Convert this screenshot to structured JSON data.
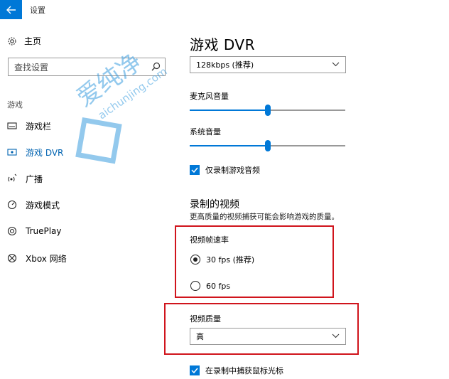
{
  "window": {
    "title": "设置"
  },
  "sidebar": {
    "home_label": "主页",
    "search_placeholder": "查找设置",
    "section_label": "游戏",
    "items": [
      {
        "label": "游戏栏",
        "icon": "game-bar-icon"
      },
      {
        "label": "游戏 DVR",
        "icon": "dvr-icon",
        "active": true
      },
      {
        "label": "广播",
        "icon": "broadcast-icon"
      },
      {
        "label": "游戏模式",
        "icon": "game-mode-icon"
      },
      {
        "label": "TruePlay",
        "icon": "trueplay-icon"
      },
      {
        "label": "Xbox 网络",
        "icon": "xbox-icon"
      }
    ]
  },
  "main": {
    "title": "游戏 DVR",
    "bitrate_value": "128kbps (推荐)",
    "mic_volume_label": "麦克风音量",
    "mic_volume_level": 0.5,
    "system_volume_label": "系统音量",
    "system_volume_level": 0.5,
    "record_game_audio_only_label": "仅录制游戏音频",
    "record_game_audio_only_checked": true,
    "recorded_video_title": "录制的视频",
    "recorded_video_desc": "更高质量的视频捕获可能会影响游戏的质量。",
    "frame_rate_label": "视频帧速率",
    "frame_rate_options": [
      {
        "label": "30 fps (推荐)",
        "selected": true
      },
      {
        "label": "60 fps",
        "selected": false
      }
    ],
    "video_quality_label": "视频质量",
    "video_quality_value": "高",
    "capture_cursor_label": "在录制中捕获鼠标光标",
    "capture_cursor_checked": true
  },
  "watermark": {
    "text_cn": "爱纯净",
    "text_en": "aichunjing.com"
  },
  "colors": {
    "accent": "#0078d7",
    "highlight_box": "#d0141c"
  }
}
